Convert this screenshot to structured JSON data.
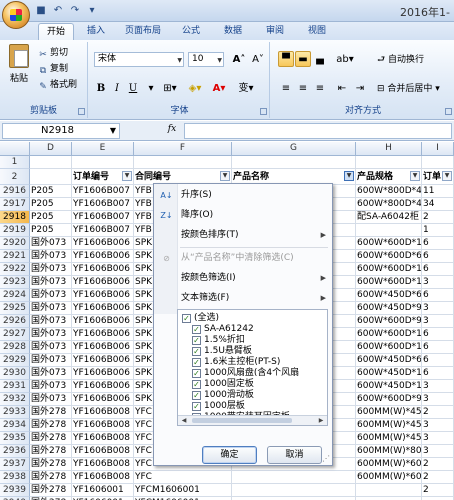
{
  "window": {
    "title": "2016年1-"
  },
  "ribbon": {
    "tabs": [
      "开始",
      "插入",
      "页面布局",
      "公式",
      "数据",
      "审阅",
      "视图"
    ],
    "clipboard": {
      "paste": "粘贴",
      "cut": "剪切",
      "copy": "复制",
      "format_painter": "格式刷",
      "group_label": "剪贴板"
    },
    "font": {
      "name": "宋体",
      "size": "10",
      "grow": "A˄",
      "shrink": "A˅",
      "bold": "B",
      "italic": "I",
      "underline": "U",
      "wen": "变",
      "group_label": "字体"
    },
    "alignment": {
      "wrap": "自动换行",
      "merge": "合并后居中",
      "group_label": "对齐方式"
    }
  },
  "formula_bar": {
    "name_box": "N2918",
    "fx": "fx",
    "formula": ""
  },
  "grid": {
    "columns": [
      "D",
      "E",
      "F",
      "G",
      "H",
      "I"
    ],
    "header_row": {
      "D": "",
      "E": "订单编号",
      "F": "合同编号",
      "G": "产品名称",
      "H": "产品规格",
      "I": "订单"
    },
    "rows": [
      {
        "n": "1",
        "D": "",
        "E": "",
        "F": "",
        "H": "",
        "I": ""
      },
      {
        "n": "2",
        "D": "",
        "E": "订单编号",
        "F": "合同编号",
        "H": "产品规格",
        "I": "订单"
      },
      {
        "n": "2916",
        "D": "P205",
        "E": "YF1606B007",
        "F": "YFB",
        "H": "600W*800D*42U",
        "I": "11"
      },
      {
        "n": "2917",
        "D": "P205",
        "E": "YF1606B007",
        "F": "YFB",
        "H": "600W*800D*42U",
        "I": "34"
      },
      {
        "n": "2918",
        "D": "P205",
        "E": "YF1606B007",
        "F": "YFB",
        "H": "配SA-A6042柜",
        "I": "2"
      },
      {
        "n": "2919",
        "D": "P205",
        "E": "YF1606B007",
        "F": "YFB",
        "H": "",
        "I": "1"
      },
      {
        "n": "2920",
        "D": "国外073",
        "E": "YF1606B006",
        "F": "SPK",
        "H": "600W*600D*12U",
        "I": "6"
      },
      {
        "n": "2921",
        "D": "国外073",
        "E": "YF1606B006",
        "F": "SPK",
        "H": "600W*600D*6U",
        "I": "6"
      },
      {
        "n": "2922",
        "D": "国外073",
        "E": "YF1606B006",
        "F": "SPK",
        "H": "600W*600D*12U",
        "I": "6"
      },
      {
        "n": "2923",
        "D": "国外073",
        "E": "YF1606B006",
        "F": "SPK",
        "H": "600W*600D*18U",
        "I": "3"
      },
      {
        "n": "2924",
        "D": "国外073",
        "E": "YF1606B006",
        "F": "SPK",
        "H": "600W*450D*6U",
        "I": "6"
      },
      {
        "n": "2925",
        "D": "国外073",
        "E": "YF1606B006",
        "F": "SPK",
        "H": "600W*450D*9U",
        "I": "3"
      },
      {
        "n": "2926",
        "D": "国外073",
        "E": "YF1606B006",
        "F": "SPK",
        "H": "600W*600D*9U",
        "I": "3"
      },
      {
        "n": "2927",
        "D": "国外073",
        "E": "YF1606B006",
        "F": "SPK",
        "H": "600W*600D*12U",
        "I": "6"
      },
      {
        "n": "2928",
        "D": "国外073",
        "E": "YF1606B006",
        "F": "SPK",
        "H": "600W*600D*18U",
        "I": "6"
      },
      {
        "n": "2929",
        "D": "国外073",
        "E": "YF1606B006",
        "F": "SPK",
        "H": "600W*450D*6U",
        "I": "6"
      },
      {
        "n": "2930",
        "D": "国外073",
        "E": "YF1606B006",
        "F": "SPK",
        "H": "600W*450D*12U",
        "I": "6"
      },
      {
        "n": "2931",
        "D": "国外073",
        "E": "YF1606B006",
        "F": "SPK",
        "H": "600W*450D*18U",
        "I": "3"
      },
      {
        "n": "2932",
        "D": "国外073",
        "E": "YF1606B006",
        "F": "SPK",
        "H": "600W*600D*9U",
        "I": "3"
      },
      {
        "n": "2933",
        "D": "国外278",
        "E": "YF1606B008",
        "F": "YFC",
        "H": "600MM(W)*450MM(D)*9",
        "I": "2"
      },
      {
        "n": "2934",
        "D": "国外278",
        "E": "YF1606B008",
        "F": "YFC",
        "H": "600MM(W)*450MM(D)*1",
        "I": "3"
      },
      {
        "n": "2935",
        "D": "国外278",
        "E": "YF1606B008",
        "F": "YFC",
        "H": "600MM(W)*450MM(D)*1",
        "I": "3"
      },
      {
        "n": "2936",
        "D": "国外278",
        "E": "YF1606B008",
        "F": "YFC",
        "H": "600MM(W)*800MM(D)*1",
        "I": "3"
      },
      {
        "n": "2937",
        "D": "国外278",
        "E": "YF1606B008",
        "F": "YFC",
        "H": "600MM(W)*600MM(D)*2",
        "I": "2"
      },
      {
        "n": "2938",
        "D": "国外278",
        "E": "YF1606B008",
        "F": "YFC",
        "H": "600MM(W)*600MM(D)*1",
        "I": "2"
      },
      {
        "n": "2939",
        "D": "国外278",
        "E": "YF1606001",
        "F": "YFCM1606001",
        "H": "",
        "I": "2"
      },
      {
        "n": "2940",
        "D": "国外278",
        "E": "YF1606001",
        "F": "YFCM1606001",
        "H": "",
        "I": ""
      }
    ]
  },
  "filter_menu": {
    "sort_asc": "升序(S)",
    "sort_desc": "降序(O)",
    "sort_color": "按颜色排序(T)",
    "clear_filter": "从“产品名称”中清除筛选(C)",
    "filter_color": "按颜色筛选(I)",
    "text_filter": "文本筛选(F)",
    "items": [
      "(全选)",
      "SA-A61242",
      "1.5%折扣",
      "1.5U悬臂板",
      "1.6米主控柜(PT-S)",
      "1000风扇盘(含4个风扇",
      "1000固定板",
      "1000滑动板",
      "1000层板",
      "1000带安装耳固定板",
      "1000高底座"
    ],
    "ok": "确定",
    "cancel": "取消"
  }
}
